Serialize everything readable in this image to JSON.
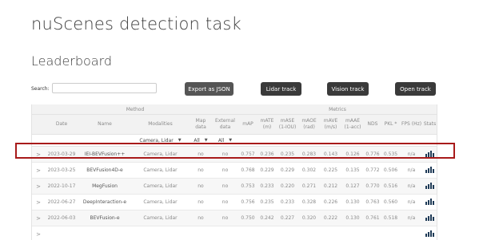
{
  "page": {
    "title": "nuScenes detection task",
    "section_title": "Leaderboard"
  },
  "search": {
    "label": "Search:",
    "value": "",
    "placeholder": ""
  },
  "toolbar": {
    "export_label": "Export as JSON",
    "lidar_label": "Lidar track",
    "vision_label": "Vision track",
    "open_label": "Open track"
  },
  "table": {
    "groups": {
      "method": "Method",
      "metrics": "Metrics"
    },
    "headers": {
      "date": "Date",
      "name": "Name",
      "modalities": "Modalities",
      "map_data": "Map data",
      "external_data": "External data",
      "map": "mAP",
      "mate": "mATE (m)",
      "mase": "mASE (1-IOU)",
      "maoe": "mAOE (rad)",
      "mave": "mAVE (m/s)",
      "maae": "mAAE (1-acc)",
      "nds": "NDS",
      "pkl": "PKL *",
      "fps": "FPS (Hz)",
      "stats": "Stats"
    },
    "filters": {
      "modalities": "Camera, Lidar",
      "map_data": "All",
      "external_data": "All"
    },
    "rows": [
      {
        "chevron": ">",
        "date": "2023-03-29",
        "name": "IEI-BEVFusion++",
        "modalities": "Camera, Lidar",
        "map_data": "no",
        "external_data": "no",
        "map": "0.757",
        "mate": "0.236",
        "mase": "0.235",
        "maoe": "0.283",
        "mave": "0.143",
        "maae": "0.126",
        "nds": "0.776",
        "pkl": "0.535",
        "fps": "n/a"
      },
      {
        "chevron": ">",
        "date": "2023-03-25",
        "name": "BEVFusion4D-e",
        "modalities": "Camera, Lidar",
        "map_data": "no",
        "external_data": "no",
        "map": "0.768",
        "mate": "0.229",
        "mase": "0.229",
        "maoe": "0.302",
        "mave": "0.225",
        "maae": "0.135",
        "nds": "0.772",
        "pkl": "0.506",
        "fps": "n/a"
      },
      {
        "chevron": ">",
        "date": "2022-10-17",
        "name": "MegFusion",
        "modalities": "Camera, Lidar",
        "map_data": "no",
        "external_data": "no",
        "map": "0.753",
        "mate": "0.233",
        "mase": "0.220",
        "maoe": "0.271",
        "mave": "0.212",
        "maae": "0.127",
        "nds": "0.770",
        "pkl": "0.516",
        "fps": "n/a"
      },
      {
        "chevron": ">",
        "date": "2022-06-27",
        "name": "DeepInteraction-e",
        "modalities": "Camera, Lidar",
        "map_data": "no",
        "external_data": "no",
        "map": "0.756",
        "mate": "0.235",
        "mase": "0.233",
        "maoe": "0.328",
        "mave": "0.226",
        "maae": "0.130",
        "nds": "0.763",
        "pkl": "0.560",
        "fps": "n/a"
      },
      {
        "chevron": ">",
        "date": "2022-06-03",
        "name": "BEVFusion-e",
        "modalities": "Camera, Lidar",
        "map_data": "no",
        "external_data": "no",
        "map": "0.750",
        "mate": "0.242",
        "mase": "0.227",
        "maoe": "0.320",
        "mave": "0.222",
        "maae": "0.130",
        "nds": "0.761",
        "pkl": "0.518",
        "fps": "n/a"
      },
      {
        "chevron": ">",
        "date": "",
        "name": "",
        "modalities": "",
        "map_data": "",
        "external_data": "",
        "map": "",
        "mate": "",
        "mase": "",
        "maoe": "",
        "mave": "",
        "maae": "",
        "nds": "",
        "pkl": "",
        "fps": ""
      }
    ],
    "stats_icon": "bar-chart-icon",
    "highlight_color": "#a81a1a"
  }
}
